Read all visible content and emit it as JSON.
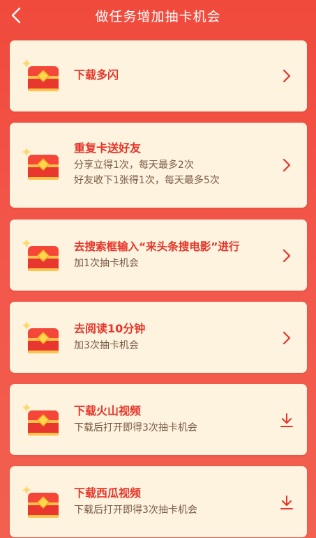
{
  "header": {
    "title": "做任务增加抽卡机会",
    "back_icon": "chevron-left-icon"
  },
  "colors": {
    "background": "#f04a3c",
    "card": "#fdf3de",
    "accent": "#e7352b",
    "subtext": "#7a5a45"
  },
  "tasks": [
    {
      "title": "下载多闪",
      "subtitles": [],
      "action_icon": "chevron-right-icon"
    },
    {
      "title": "重复卡送好友",
      "subtitles": [
        "分享立得1次，每天最多2次",
        "好友收下1张得1次，每天最多5次"
      ],
      "action_icon": "chevron-right-icon"
    },
    {
      "title": "去搜索框输入“来头条搜电影”进行",
      "subtitles": [
        "加1次抽卡机会"
      ],
      "action_icon": "chevron-right-icon"
    },
    {
      "title": "去阅读10分钟",
      "subtitles": [
        "加3次抽卡机会"
      ],
      "action_icon": "chevron-right-icon"
    },
    {
      "title": "下载火山视频",
      "subtitles": [
        "下载后打开即得3次抽卡机会"
      ],
      "action_icon": "download-icon"
    },
    {
      "title": "下载西瓜视频",
      "subtitles": [
        "下载后打开即得3次抽卡机会"
      ],
      "action_icon": "download-icon"
    }
  ]
}
